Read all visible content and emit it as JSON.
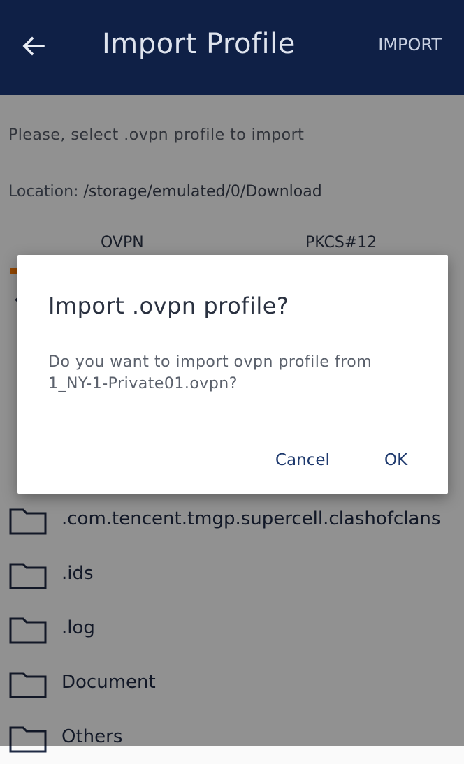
{
  "appbar": {
    "title": "Import Profile",
    "action_label": "IMPORT",
    "back_icon": "arrow-left-icon",
    "color": "#0f2046"
  },
  "content": {
    "hint": "Please, select .ovpn profile to import",
    "location_label": "Location:",
    "location_path": "/storage/emulated/0/Download",
    "tabs": [
      {
        "label": "OVPN"
      },
      {
        "label": "PKCS#12"
      }
    ],
    "accent_color": "#ff7a00",
    "files": [
      {
        "name": ".com.tencent.tmgp.supercell.clashofclans",
        "icon": "folder-icon"
      },
      {
        "name": ".ids",
        "icon": "folder-icon"
      },
      {
        "name": ".log",
        "icon": "folder-icon"
      },
      {
        "name": "Document",
        "icon": "folder-icon"
      },
      {
        "name": "Others",
        "icon": "folder-icon"
      }
    ]
  },
  "dialog": {
    "title": "Import .ovpn profile?",
    "message": "Do you want to import ovpn profile from 1_NY-1-Private01.ovpn?",
    "cancel_label": "Cancel",
    "ok_label": "OK"
  }
}
